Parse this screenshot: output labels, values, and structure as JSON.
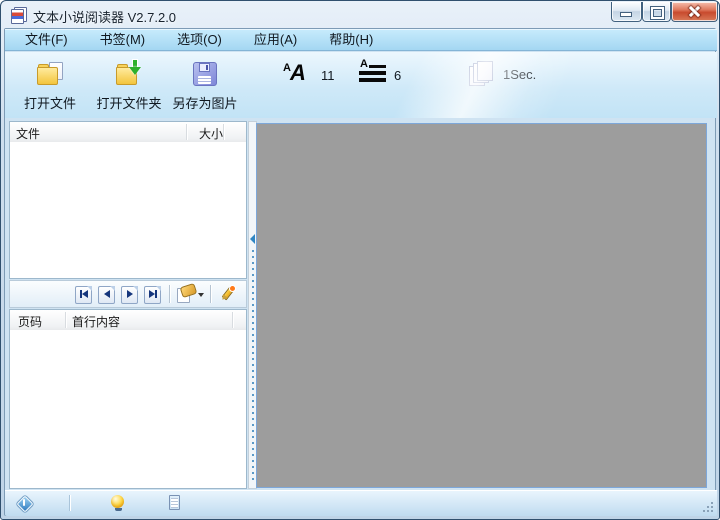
{
  "window": {
    "title": "文本小说阅读器 V2.7.2.0"
  },
  "menu": {
    "items": [
      {
        "label": "文件(F)"
      },
      {
        "label": "书签(M)"
      },
      {
        "label": "选项(O)"
      },
      {
        "label": "应用(A)"
      },
      {
        "label": "帮助(H)"
      }
    ]
  },
  "toolbar": {
    "buttons": [
      {
        "label": "打开文件",
        "icon": "open-file-folder-document-icon"
      },
      {
        "label": "打开文件夹",
        "icon": "open-folder-green-arrow-icon"
      },
      {
        "label": "另存为图片",
        "icon": "save-floppy-disk-icon"
      }
    ],
    "font_size": {
      "value": "11",
      "slider_fraction": 0.17
    },
    "line_spacing": {
      "value": "6",
      "slider_fraction": 0.26
    },
    "page_interval": {
      "value": "1Sec.",
      "slider_fraction": 0.17
    }
  },
  "file_list": {
    "columns": [
      {
        "label": "文件"
      },
      {
        "label": "大小"
      }
    ],
    "rows": []
  },
  "bookmark_list": {
    "columns": [
      {
        "label": "页码"
      },
      {
        "label": "首行内容"
      }
    ],
    "rows": []
  },
  "nav_toolbar": {
    "buttons": [
      "first-page",
      "previous-page",
      "next-page",
      "last-page",
      "bookmark-menu",
      "edit-bookmark"
    ]
  },
  "status_bar": {
    "icons": [
      "info-diamond",
      "lamp",
      "notepad"
    ]
  },
  "reader": {
    "background": "#9d9d9d"
  },
  "colors": {
    "menu_bar_blue": "#a9dbf5",
    "toolbar_blue": "#cde9f8",
    "accent_blue": "#2f86c4",
    "close_button_red": "#cf5b40",
    "content_gray": "#9d9d9d"
  }
}
